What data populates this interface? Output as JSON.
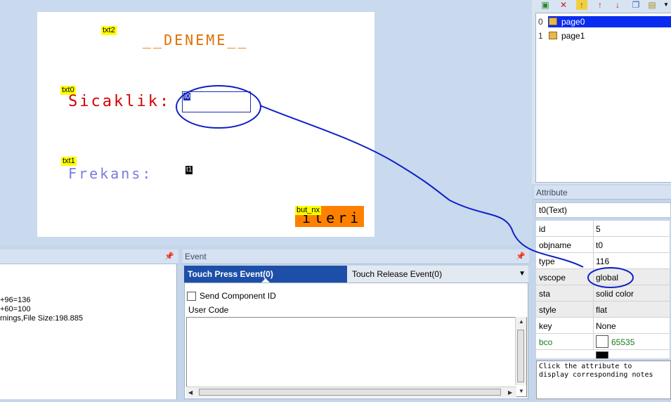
{
  "canvas": {
    "tags": {
      "txt2": "txt2",
      "txt0": "txt0",
      "txt1": "txt1",
      "but_nx": "but_nx"
    },
    "title_text": "__DENEME__",
    "sicaklik_text": "Sicaklik:",
    "frekans_text": "Frekans:",
    "t0_label": "t0",
    "t1_label": "t1",
    "button_text": "ileri",
    "colors": {
      "title": "#e07000",
      "sicaklik": "#d40000",
      "frekans": "#7a7ae0",
      "button_bg": "#ff8000"
    }
  },
  "pages": {
    "toolbar_icons": [
      "add-page-icon",
      "delete-page-icon",
      "insert-page-icon",
      "move-up-icon",
      "move-down-icon",
      "copy-page-icon",
      "import-page-icon",
      "dropdown-icon"
    ],
    "items": [
      {
        "num": "0",
        "name": "page0",
        "selected": true
      },
      {
        "num": "1",
        "name": "page1",
        "selected": false
      }
    ]
  },
  "attribute": {
    "header": "Attribute",
    "object": "t0(Text)",
    "rows": [
      {
        "key": "id",
        "value": "5"
      },
      {
        "key": "objname",
        "value": "t0"
      },
      {
        "key": "type",
        "value": "116"
      },
      {
        "key": "vscope",
        "value": "global"
      },
      {
        "key": "sta",
        "value": "solid color"
      },
      {
        "key": "style",
        "value": "flat"
      },
      {
        "key": "key",
        "value": "None"
      },
      {
        "key": "bco",
        "value": "65535"
      }
    ],
    "notes": "Click the attribute to\ndisplay corresponding notes"
  },
  "output": {
    "lines": [
      "+96=136",
      "+60=100",
      "rnings,File Size:198.885"
    ]
  },
  "event": {
    "header": "Event",
    "tab_press": "Touch Press Event(0)",
    "tab_release": "Touch Release Event(0)",
    "send_component_id": "Send Component ID",
    "user_code_label": "User Code",
    "user_code": ""
  }
}
